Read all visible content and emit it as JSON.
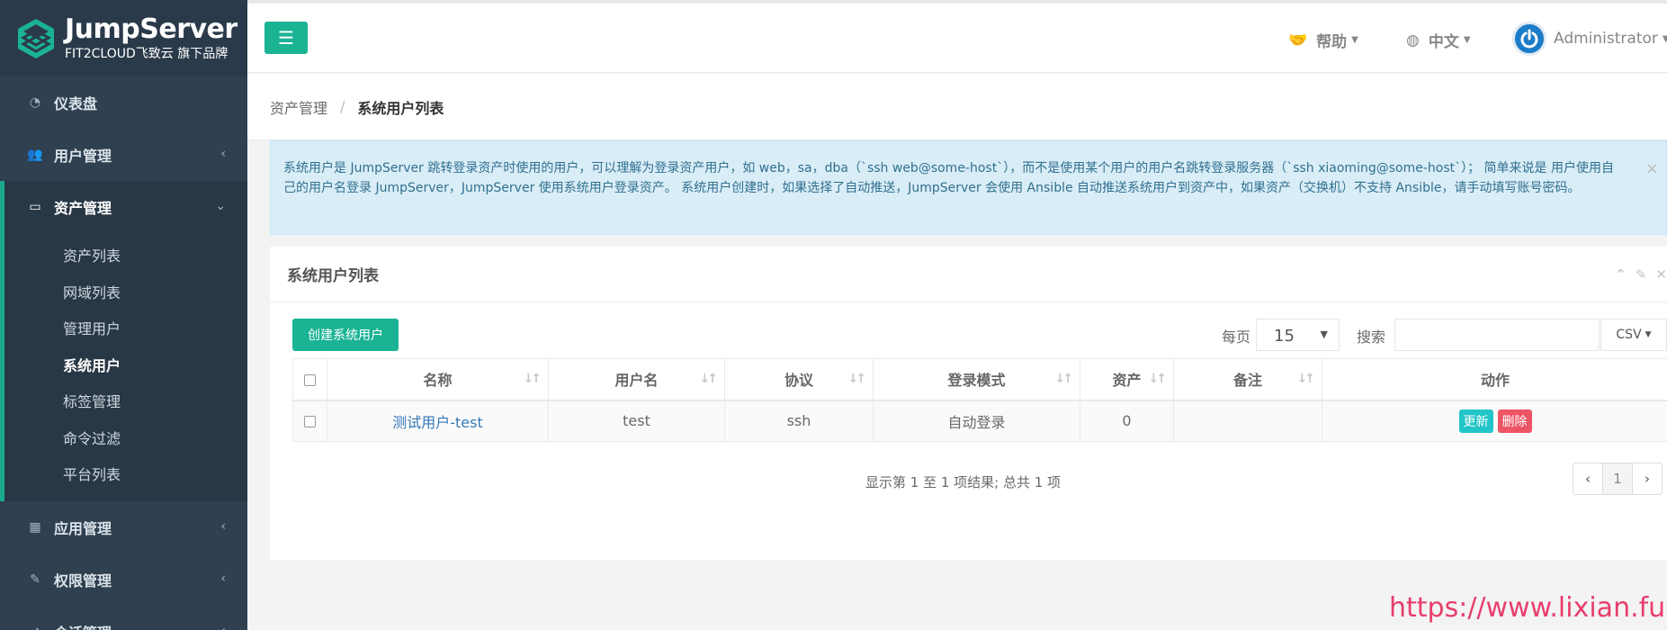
{
  "brand": {
    "title": "JumpServer",
    "subtitle": "FIT2CLOUD飞致云 旗下品牌"
  },
  "sidebar": {
    "items": [
      {
        "label": "仪表盘",
        "icon": "dashboard-icon"
      },
      {
        "label": "用户管理",
        "icon": "users-icon"
      },
      {
        "label": "资产管理",
        "icon": "inbox-icon"
      },
      {
        "label": "应用管理",
        "icon": "grid-icon"
      },
      {
        "label": "权限管理",
        "icon": "edit-icon"
      },
      {
        "label": "会话管理",
        "icon": "rocket-icon"
      }
    ],
    "asset_subitems": [
      "资产列表",
      "网域列表",
      "管理用户",
      "系统用户",
      "标签管理",
      "命令过滤",
      "平台列表"
    ]
  },
  "topbar": {
    "help_label": "帮助",
    "lang_label": "中文",
    "user_label": "Administrator"
  },
  "breadcrumb": {
    "parent": "资产管理",
    "current": "系统用户列表"
  },
  "alert": {
    "text": "系统用户是 JumpServer 跳转登录资产时使用的用户，可以理解为登录资产用户，如 web，sa，dba（`ssh web@some-host`），而不是使用某个用户的用户名跳转登录服务器（`ssh xiaoming@some-host`）； 简单来说是 用户使用自己的用户名登录 JumpServer，JumpServer 使用系统用户登录资产。 系统用户创建时，如果选择了自动推送，JumpServer 会使用 Ansible 自动推送系统用户到资产中，如果资产（交换机）不支持 Ansible，请手动填写账号密码。",
    "close": "×"
  },
  "panel": {
    "title": "系统用户列表",
    "create_label": "创建系统用户",
    "perpage_label": "每页",
    "perpage_value": "15",
    "search_label": "搜索",
    "search_value": "",
    "export_label": "CSV"
  },
  "table": {
    "columns": [
      "名称",
      "用户名",
      "协议",
      "登录模式",
      "资产",
      "备注",
      "动作"
    ],
    "rows": [
      {
        "name": "测试用户-test",
        "username": "test",
        "protocol": "ssh",
        "login_mode": "自动登录",
        "assets": "0",
        "comment": "",
        "update_label": "更新",
        "delete_label": "删除"
      }
    ]
  },
  "pagination": {
    "info": "显示第 1 至 1 项结果; 总共 1 项",
    "prev": "‹",
    "page": "1",
    "next": "›"
  },
  "watermark": "https://www.lixian.fun",
  "colors": {
    "primary": "#1ab394",
    "sidebar": "#2f4050",
    "info": "#23c6c8",
    "danger": "#ed5565",
    "link": "#337ab7"
  }
}
